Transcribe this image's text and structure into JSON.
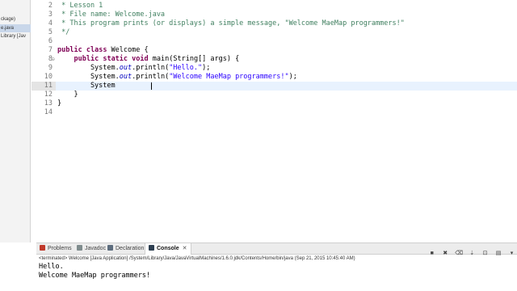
{
  "package_explorer": {
    "items": [
      {
        "label": "ckage)",
        "selected": false
      },
      {
        "label": "e.java",
        "selected": true
      },
      {
        "label": "Library [Jav",
        "selected": false
      }
    ]
  },
  "editor": {
    "file": "Welcome.java",
    "current_line": "11",
    "lines": [
      {
        "n": "2",
        "text": " * Lesson 1"
      },
      {
        "n": "3",
        "text": " * File name: Welcome.java"
      },
      {
        "n": "4",
        "text": " * This program prints (or displays) a simple message, \"Welcome MaeMap programmers!\""
      },
      {
        "n": "5",
        "text": " */"
      },
      {
        "n": "6",
        "text": ""
      },
      {
        "n": "7",
        "text": "public class Welcome {"
      },
      {
        "n": "8",
        "text": "    public static void main(String[] args) {"
      },
      {
        "n": "9",
        "text": "        System.out.println(\"Hello.\");"
      },
      {
        "n": "10",
        "text": "        System.out.println(\"Welcome MaeMap programmers!\");"
      },
      {
        "n": "11",
        "text": "        System"
      },
      {
        "n": "12",
        "text": "    }"
      },
      {
        "n": "13",
        "text": "}"
      },
      {
        "n": "14",
        "text": ""
      }
    ]
  },
  "views": {
    "tabs": [
      {
        "label": "Problems",
        "icon": "problems-icon",
        "color": "#c0392b"
      },
      {
        "label": "Javadoc",
        "icon": "javadoc-icon",
        "color": "#7f8c8d"
      },
      {
        "label": "Declaration",
        "icon": "declaration-icon",
        "color": "#5d6d7e"
      },
      {
        "label": "Console",
        "icon": "console-icon",
        "color": "#2c3e50",
        "active": true
      }
    ],
    "close_glyph": "✕",
    "terminated": "<terminated> Welcome [Java Application] /System/Library/Java/JavaVirtualMachines/1.6.0.jdk/Contents/Home/bin/java (Sep 21, 2015 10:45:40 AM)",
    "output": [
      "Hello.",
      "Welcome MaeMap programmers!"
    ],
    "toolbar_icons": [
      "terminate-icon",
      "remove-launch-icon",
      "clear-console-icon",
      "scroll-lock-icon",
      "pin-console-icon",
      "display-console-icon",
      "open-console-icon"
    ]
  },
  "colors": {
    "comment": "#3f7f5f",
    "keyword": "#7f0055",
    "string": "#2a00ff",
    "static_field": "#0000c0",
    "current_line": "#e8f2fe"
  }
}
